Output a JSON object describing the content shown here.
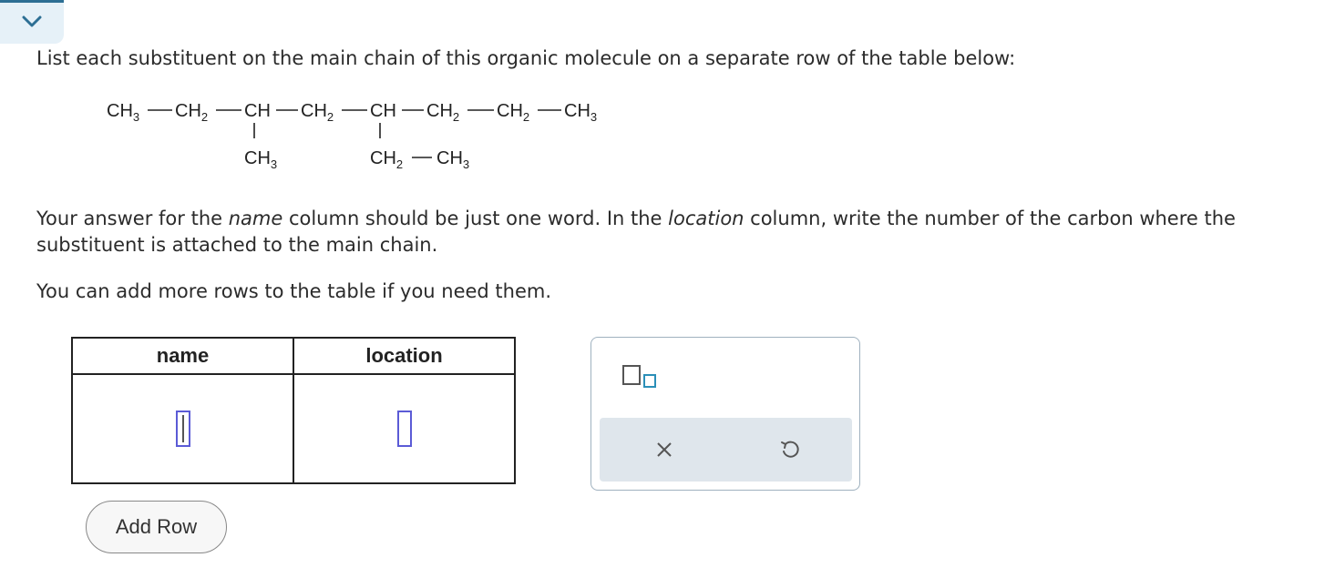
{
  "prompt": {
    "intro": "List each substituent on the main chain of this organic molecule on a separate row of the table below:",
    "instructions_part1": "Your answer for the ",
    "instructions_em1": "name",
    "instructions_part2": " column should be just one word. In the ",
    "instructions_em2": "location",
    "instructions_part3": " column, write the number of the carbon where the substituent is attached to the main chain.",
    "add_more": "You can add more rows to the table if you need them."
  },
  "molecule": {
    "main_chain": [
      {
        "base": "CH",
        "sub": "3"
      },
      {
        "base": "CH",
        "sub": "2"
      },
      {
        "base": "CH",
        "sub": ""
      },
      {
        "base": "CH",
        "sub": "2"
      },
      {
        "base": "CH",
        "sub": ""
      },
      {
        "base": "CH",
        "sub": "2"
      },
      {
        "base": "CH",
        "sub": "2"
      },
      {
        "base": "CH",
        "sub": "3"
      }
    ],
    "branch1": {
      "base": "CH",
      "sub": "3"
    },
    "branch2": [
      {
        "base": "CH",
        "sub": "2"
      },
      {
        "base": "CH",
        "sub": "3"
      }
    ]
  },
  "table": {
    "headers": [
      "name",
      "location"
    ],
    "rows": [
      {
        "name": "",
        "location": ""
      }
    ]
  },
  "buttons": {
    "add_row": "Add Row"
  },
  "icons": {
    "collapse": "chevron-down-icon",
    "superscript": "superscript-box-icon",
    "clear": "close-icon",
    "undo": "undo-icon"
  },
  "colors": {
    "accent": "#2d6f94",
    "input_border": "#5b5bd6",
    "tool_footer": "#dfe6ec"
  }
}
